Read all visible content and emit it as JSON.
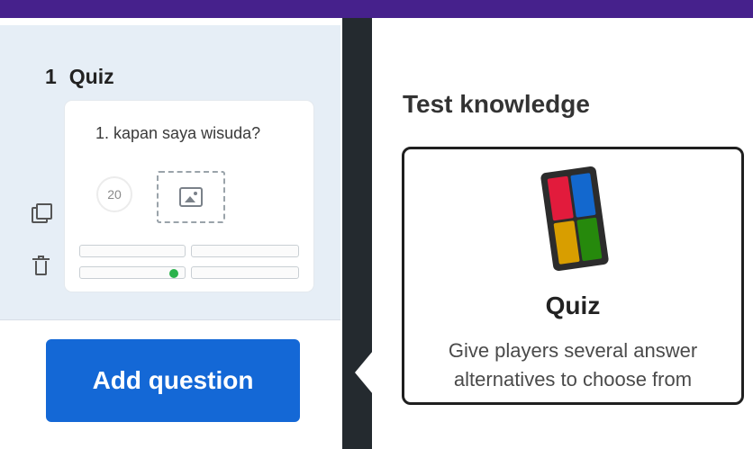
{
  "slide": {
    "number": "1",
    "type": "Quiz",
    "question": "1. kapan saya wisuda?",
    "time_limit": "20"
  },
  "left_panel": {
    "add_question_label": "Add question"
  },
  "right_panel": {
    "heading": "Test knowledge",
    "options": [
      {
        "title": "Quiz",
        "description_line1": "Give players several answer",
        "description_line2": "alternatives to choose from",
        "icon": "quiz-icon",
        "colors": [
          "#e21b3c",
          "#1368ce",
          "#d89e00",
          "#26890c"
        ]
      }
    ]
  },
  "colors": {
    "topbar": "#46218c",
    "primary_button": "#1468d6",
    "divider": "#242a2f"
  }
}
